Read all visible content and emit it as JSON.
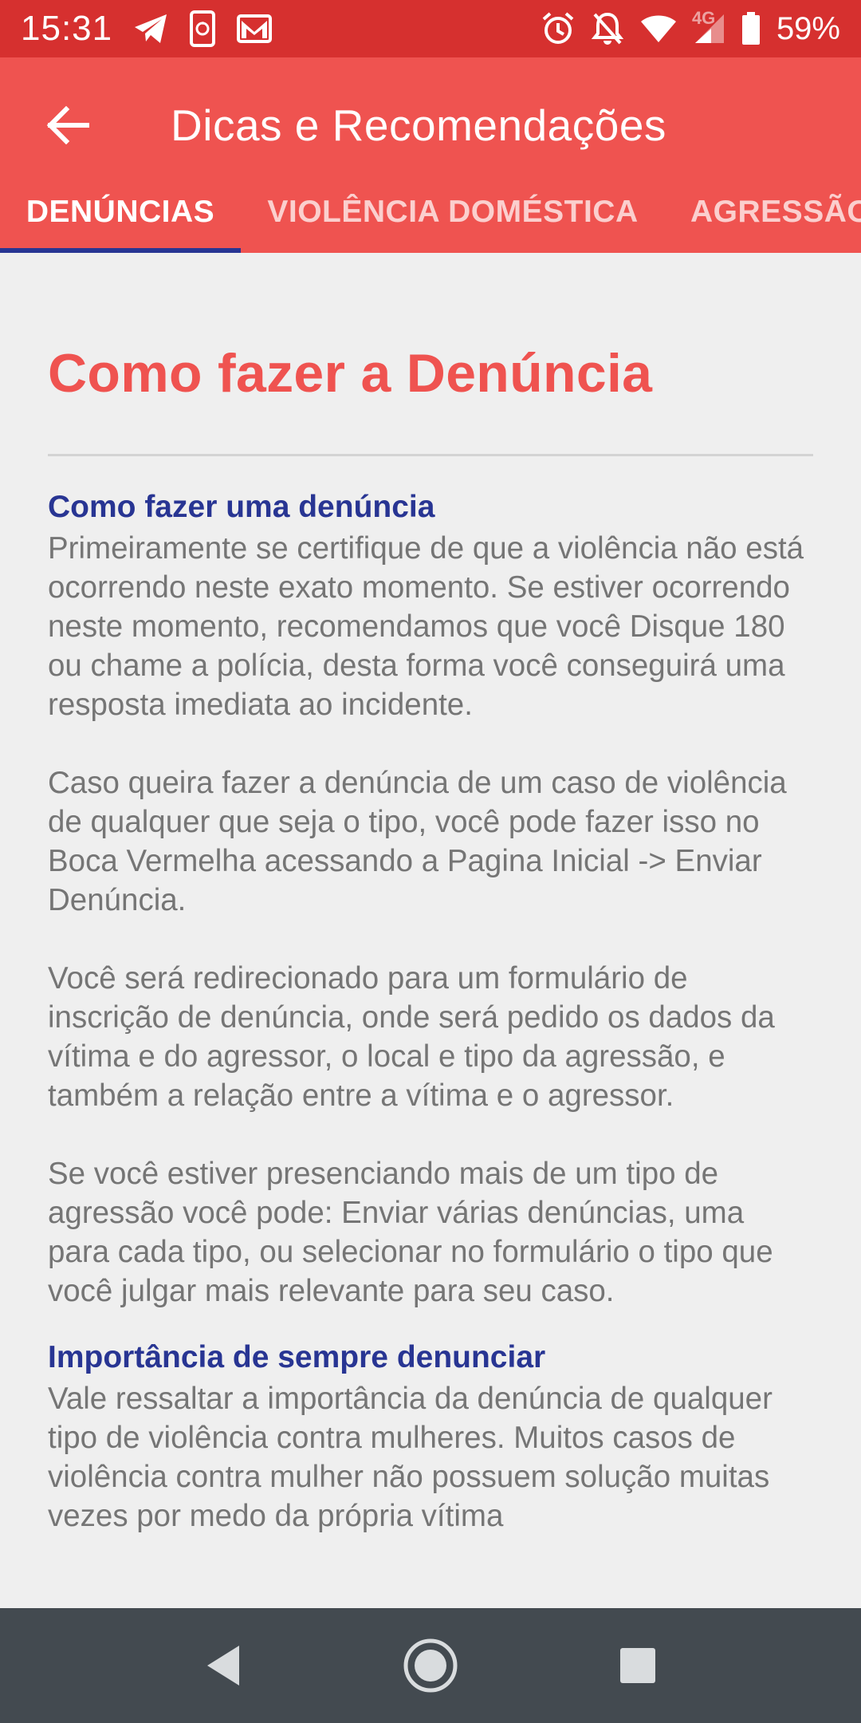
{
  "status_bar": {
    "time": "15:31",
    "network_type": "4G",
    "battery": "59%",
    "left_icons": [
      "telegram-icon",
      "phone-sync-icon",
      "gmail-icon"
    ],
    "right_icons": [
      "alarm-icon",
      "notifications-off-icon",
      "wifi-icon",
      "cell-signal-icon",
      "battery-icon"
    ]
  },
  "app_bar": {
    "title": "Dicas e Recomendações",
    "back_icon": "arrow-back-icon",
    "background_color": "#ef5350"
  },
  "tabs": [
    {
      "label": "DENÚNCIAS",
      "active": true
    },
    {
      "label": "VIOLÊNCIA DOMÉSTICA",
      "active": false
    },
    {
      "label": "AGRESSÃO",
      "active": false
    }
  ],
  "content": {
    "heading": "Como fazer a Denúncia",
    "sections": [
      {
        "title": "Como fazer uma denúncia",
        "paragraphs": [
          "Primeiramente se certifique de que a violência não está ocorrendo neste exato momento. Se estiver ocorrendo neste momento, recomendamos que você Disque 180 ou chame a polícia, desta forma você conseguirá uma resposta imediata ao incidente.",
          "Caso queira fazer a denúncia de um caso de violência de qualquer que seja o tipo, você pode fazer isso no Boca Vermelha acessando a Pagina Inicial -> Enviar Denúncia.",
          "Você será redirecionado para um formulário de inscrição de denúncia, onde será pedido os dados da vítima e do agressor, o local e tipo da agressão, e também a relação entre a vítima e o agressor.",
          "Se você estiver presenciando mais de um tipo de agressão você pode: Enviar várias denúncias, uma para cada tipo, ou selecionar no formulário o tipo que você julgar mais relevante para seu caso."
        ]
      },
      {
        "title": "Importância de sempre denunciar",
        "paragraphs": [
          "Vale ressaltar a importância da denúncia de qualquer tipo de violência contra mulheres. Muitos casos de violência contra mulher não possuem solução muitas vezes por medo da própria vítima"
        ]
      }
    ]
  },
  "nav_bar": {
    "buttons": [
      "back-triangle-icon",
      "home-circle-icon",
      "recents-square-icon"
    ]
  },
  "colors": {
    "status_bar": "#d6302f",
    "accent_red": "#ef5350",
    "section_blue": "#283593",
    "body_text": "#757575",
    "background": "#efefef",
    "nav_bar": "#434a50"
  }
}
